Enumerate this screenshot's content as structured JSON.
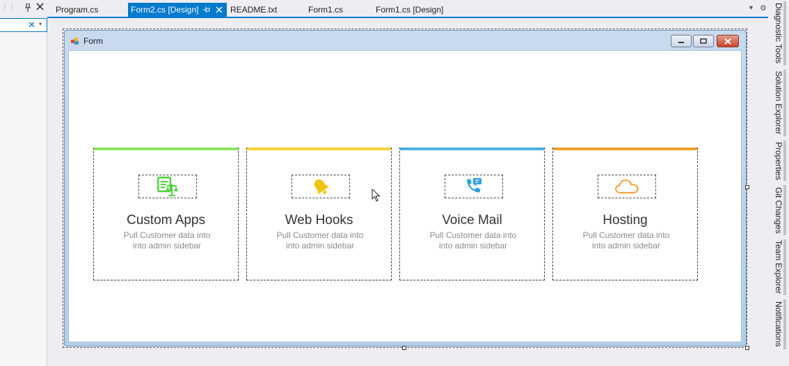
{
  "left_panel": {
    "clear_glyph": "✕",
    "dropdown_glyph": "▾"
  },
  "tabs": [
    {
      "label": "Program.cs",
      "active": false
    },
    {
      "label": "Form2.cs [Design]",
      "active": true
    },
    {
      "label": "README.txt",
      "active": false
    },
    {
      "label": "Form1.cs",
      "active": false
    },
    {
      "label": "Form1.cs [Design]",
      "active": false
    }
  ],
  "right_rail": [
    "Diagnostic Tools",
    "Solution Explorer",
    "Properties",
    "Git Changes",
    "Team Explorer",
    "Notifications"
  ],
  "form": {
    "title": "Form",
    "minimize_glyph": "▁",
    "maximize_glyph": "▫",
    "close_glyph": "✕"
  },
  "cards": [
    {
      "title": "Custom Apps",
      "desc_line1": "Pull Customer data into",
      "desc_line2": "into admin sidebar",
      "accent": "#8ee65a",
      "icon": "apps-scale-icon",
      "icon_color": "#4cd43a"
    },
    {
      "title": "Web Hooks",
      "desc_line1": "Pull Customer data into",
      "desc_line2": "into admin sidebar",
      "accent": "#f5d33a",
      "icon": "bell-icon",
      "icon_color": "#f1c40f"
    },
    {
      "title": "Voice Mail",
      "desc_line1": "Pull Customer data into",
      "desc_line2": "into admin sidebar",
      "accent": "#4ab0e6",
      "icon": "phone-message-icon",
      "icon_color": "#2d9fe0"
    },
    {
      "title": "Hosting",
      "desc_line1": "Pull Customer data into",
      "desc_line2": "into admin sidebar",
      "accent": "#f0a030",
      "icon": "cloud-icon",
      "icon_color": "#f2a23a"
    }
  ],
  "colors": {
    "vs_blue": "#007acc",
    "chrome_bg": "#eeeef2"
  }
}
